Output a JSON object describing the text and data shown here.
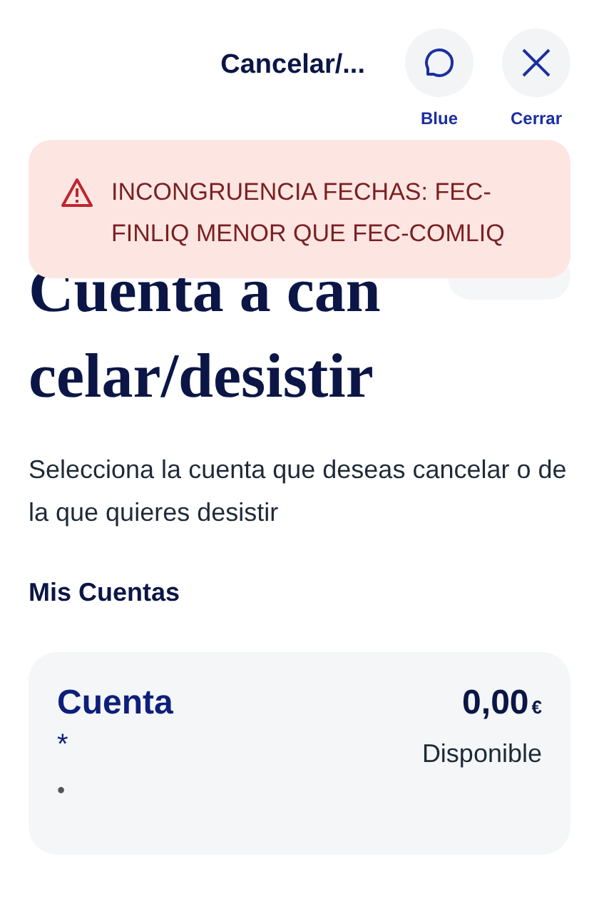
{
  "header": {
    "title": "Cancelar/...",
    "actions": [
      {
        "kind": "chat",
        "label": "Blue"
      },
      {
        "kind": "close",
        "label": "Cerrar"
      }
    ]
  },
  "alert": {
    "message": "INCONGRUENCIA FECHAS: FEC-FINLIQ MENOR QUE FEC-COMLIQ"
  },
  "page": {
    "title": "Cuenta a cancelar/desistir",
    "description": "Selecciona la cuenta que deseas cancelar o de la que quieres desistir",
    "section": "Mis Cuentas"
  },
  "accounts": [
    {
      "name": "Cuenta",
      "number": "*",
      "holder": "•",
      "amount": "0,00",
      "currency": "€",
      "balance_label": "Disponible"
    }
  ]
}
